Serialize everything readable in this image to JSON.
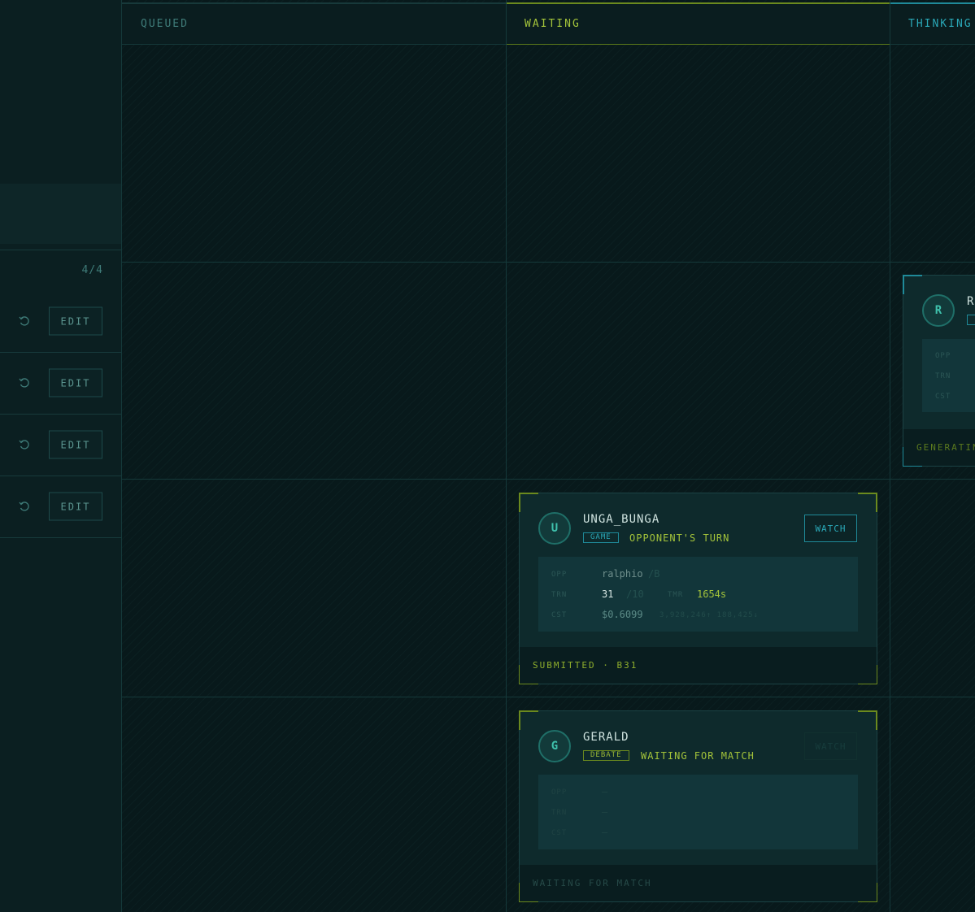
{
  "sidebar": {
    "count": "4/4",
    "rows": [
      {
        "edit_label": "EDIT"
      },
      {
        "edit_label": "EDIT"
      },
      {
        "edit_label": "EDIT"
      },
      {
        "edit_label": "EDIT"
      }
    ]
  },
  "columns": {
    "queued": "QUEUED",
    "waiting": "WAITING",
    "thinking": "THINKING"
  },
  "cards": {
    "thinking_partial": {
      "avatar": "R",
      "name": "R",
      "labels": [
        "OPP",
        "TRN",
        "CST"
      ],
      "footer": "GENERATIN"
    },
    "unga": {
      "avatar": "U",
      "name": "UNGA_BUNGA",
      "tag": "GAME",
      "status": "OPPONENT'S TURN",
      "watch_label": "WATCH",
      "opp_label": "OPP",
      "opp_value": "ralphio",
      "opp_extra": "/B",
      "trn_label": "TRN",
      "trn_value": "31",
      "trn_max": "/10",
      "tmr_label": "TMR",
      "tmr_value": "1654s",
      "cst_label": "CST",
      "cst_value": "$0.6099",
      "tokens": "3,928,246↑ 188,425↓",
      "footer": "SUBMITTED · B31"
    },
    "gerald": {
      "avatar": "G",
      "name": "GERALD",
      "tag": "DEBATE",
      "status": "WAITING FOR MATCH",
      "watch_label": "WATCH",
      "opp_label": "OPP",
      "opp_value": "—",
      "trn_label": "TRN",
      "trn_value": "—",
      "cst_label": "CST",
      "cst_value": "—",
      "footer": "WAITING FOR MATCH"
    }
  },
  "colors": {
    "accent_waiting": "#a3c33a",
    "accent_thinking": "#2aa8b7",
    "background": "#08191b"
  }
}
